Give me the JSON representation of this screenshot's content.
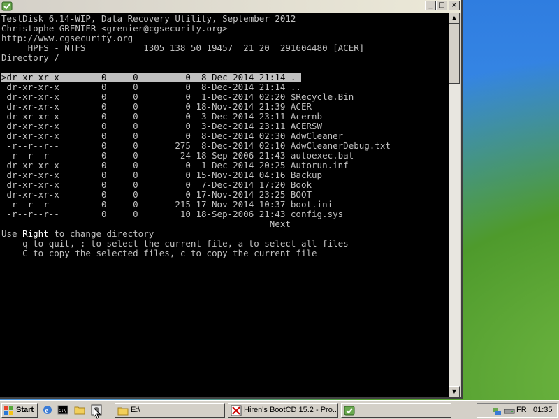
{
  "terminal": {
    "header": [
      "TestDisk 6.14-WIP, Data Recovery Utility, September 2012",
      "Christophe GRENIER <grenier@cgsecurity.org>",
      "http://www.cgsecurity.org",
      "     HPFS - NTFS           1305 138 50 19457  21 20  291604480 [ACER]",
      "Directory /"
    ],
    "files": [
      {
        "perm": "dr-xr-xr-x",
        "uid": "0",
        "gid": "0",
        "size": "0",
        "date": " 8-Dec-2014",
        "time": "21:14",
        "name": "."
      },
      {
        "perm": "dr-xr-xr-x",
        "uid": "0",
        "gid": "0",
        "size": "0",
        "date": " 8-Dec-2014",
        "time": "21:14",
        "name": ".."
      },
      {
        "perm": "dr-xr-xr-x",
        "uid": "0",
        "gid": "0",
        "size": "0",
        "date": " 1-Dec-2014",
        "time": "02:20",
        "name": "$Recycle.Bin"
      },
      {
        "perm": "dr-xr-xr-x",
        "uid": "0",
        "gid": "0",
        "size": "0",
        "date": "18-Nov-2014",
        "time": "21:39",
        "name": "ACER"
      },
      {
        "perm": "dr-xr-xr-x",
        "uid": "0",
        "gid": "0",
        "size": "0",
        "date": " 3-Dec-2014",
        "time": "23:11",
        "name": "Acernb"
      },
      {
        "perm": "dr-xr-xr-x",
        "uid": "0",
        "gid": "0",
        "size": "0",
        "date": " 3-Dec-2014",
        "time": "23:11",
        "name": "ACERSW"
      },
      {
        "perm": "dr-xr-xr-x",
        "uid": "0",
        "gid": "0",
        "size": "0",
        "date": " 8-Dec-2014",
        "time": "02:30",
        "name": "AdwCleaner"
      },
      {
        "perm": "-r--r--r--",
        "uid": "0",
        "gid": "0",
        "size": "275",
        "date": " 8-Dec-2014",
        "time": "02:10",
        "name": "AdwCleanerDebug.txt"
      },
      {
        "perm": "-r--r--r--",
        "uid": "0",
        "gid": "0",
        "size": "24",
        "date": "18-Sep-2006",
        "time": "21:43",
        "name": "autoexec.bat"
      },
      {
        "perm": "dr-xr-xr-x",
        "uid": "0",
        "gid": "0",
        "size": "0",
        "date": " 1-Dec-2014",
        "time": "20:25",
        "name": "Autorun.inf"
      },
      {
        "perm": "dr-xr-xr-x",
        "uid": "0",
        "gid": "0",
        "size": "0",
        "date": "15-Nov-2014",
        "time": "04:16",
        "name": "Backup"
      },
      {
        "perm": "dr-xr-xr-x",
        "uid": "0",
        "gid": "0",
        "size": "0",
        "date": " 7-Dec-2014",
        "time": "17:20",
        "name": "Book"
      },
      {
        "perm": "dr-xr-xr-x",
        "uid": "0",
        "gid": "0",
        "size": "0",
        "date": "17-Nov-2014",
        "time": "23:25",
        "name": "BOOT"
      },
      {
        "perm": "-r--r--r--",
        "uid": "0",
        "gid": "0",
        "size": "215",
        "date": "17-Nov-2014",
        "time": "10:37",
        "name": "boot.ini"
      },
      {
        "perm": "-r--r--r--",
        "uid": "0",
        "gid": "0",
        "size": "10",
        "date": "18-Sep-2006",
        "time": "21:43",
        "name": "config.sys"
      }
    ],
    "selected_index": 0,
    "selection_marker": ">",
    "next_label": "Next",
    "help_prefix": "Use ",
    "help_key": "Right",
    "help_suffix": " to change directory",
    "help_line2": "    q to quit, : to select the current file, a to select all files",
    "help_line3": "    C to copy the selected files, c to copy the current file"
  },
  "window_buttons": {
    "minimize": "_",
    "maximize": "□",
    "close": "×"
  },
  "taskbar": {
    "start_label": "Start",
    "tasks": [
      {
        "label": "E:\\",
        "icon": "folder-icon"
      },
      {
        "label": "Hiren's BootCD 15.2 - Pro...",
        "icon": "hirens-app-icon"
      },
      {
        "label": "",
        "icon": "testdisk-app-icon"
      }
    ],
    "tray_language": "FR",
    "clock": "01:35"
  },
  "colors": {
    "terminal_bg": "#000000",
    "terminal_fg": "#c0c0c0",
    "selection_bg": "#c0c0c0",
    "chrome": "#d4d0c8"
  }
}
